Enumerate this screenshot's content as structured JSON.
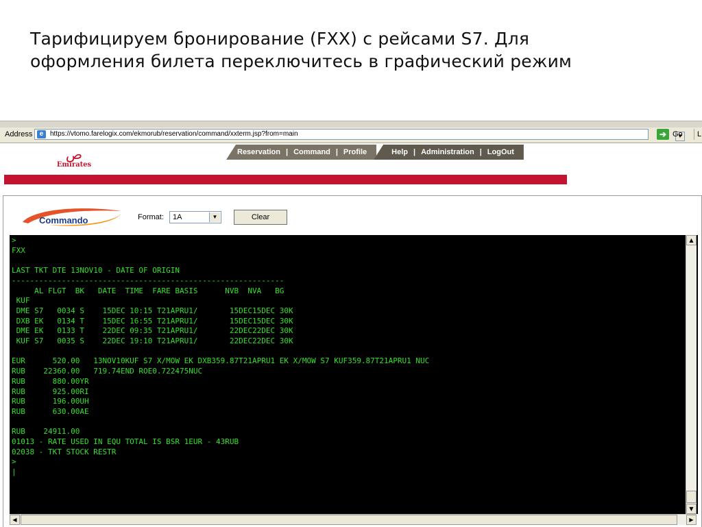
{
  "slide": {
    "title_line1": "Тарифицируем бронирование (FXX) с рейсами S7. Для",
    "title_line2": "оформления билета переключитесь в графический режим"
  },
  "browser": {
    "address_label": "Address",
    "url": "https://vtomo.farelogix.com/ekmorub/reservation/command/xxterm.jsp?from=main",
    "go_label": "Go",
    "links_label": "L"
  },
  "header": {
    "logo_text": "Emirates",
    "nav_primary": [
      "Reservation",
      "Command",
      "Profile"
    ],
    "nav_secondary": [
      "Help",
      "Administration",
      "LogOut"
    ],
    "separator": "|",
    "brand_color": "#c41230"
  },
  "toolbar": {
    "commando_label": "Commando",
    "format_label": "Format:",
    "format_value": "1A",
    "clear_label": "Clear"
  },
  "terminal": {
    "lines": [
      ">",
      "FXX",
      "",
      "LAST TKT DTE 13NOV10 - DATE OF ORIGIN",
      "------------------------------------------------------------",
      "     AL FLGT  BK   DATE  TIME  FARE BASIS      NVB  NVA   BG",
      " KUF",
      " DME S7   0034 S    15DEC 10:15 T21APRU1/       15DEC15DEC 30K",
      " DXB EK   0134 T    15DEC 16:55 T21APRU1/       15DEC15DEC 30K",
      " DME EK   0133 T    22DEC 09:35 T21APRU1/       22DEC22DEC 30K",
      " KUF S7   0035 S    22DEC 19:10 T21APRU1/       22DEC22DEC 30K",
      "",
      "EUR      520.00   13NOV10KUF S7 X/MOW EK DXB359.87T21APRU1 EK X/MOW S7 KUF359.87T21APRU1 NUC",
      "RUB    22360.00   719.74END ROE0.722475NUC",
      "RUB      880.00YR",
      "RUB      925.00RI",
      "RUB      196.00UH",
      "RUB      630.00AE",
      "",
      "RUB    24911.00",
      "01013 - RATE USED IN EQU TOTAL IS BSR 1EUR - 43RUB",
      "02038 - TKT STOCK RESTR",
      ">",
      "|"
    ],
    "text_color": "#33e02a",
    "background": "#000000"
  }
}
